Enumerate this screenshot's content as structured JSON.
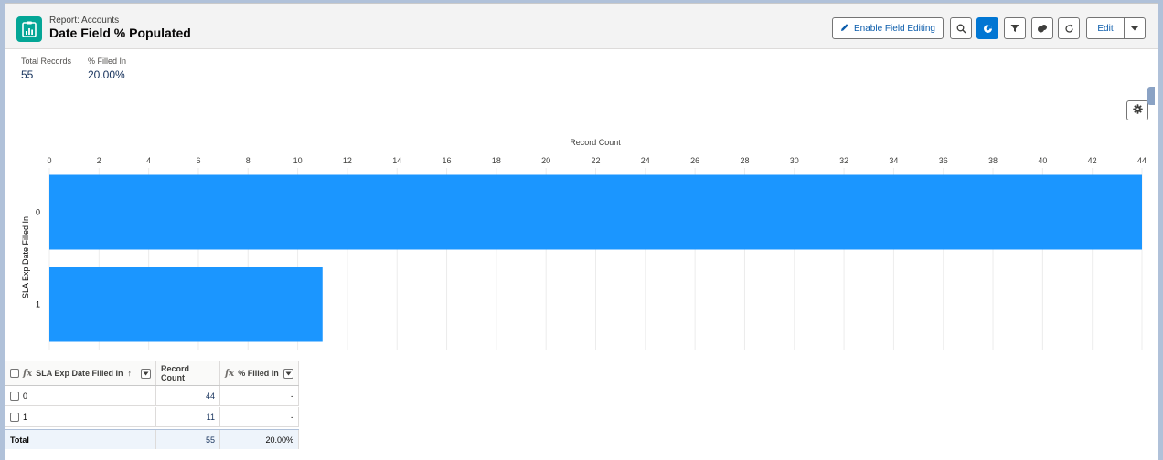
{
  "header": {
    "breadcrumb": "Report: Accounts",
    "title": "Date Field % Populated",
    "enable_field_editing_label": "Enable Field Editing",
    "edit_label": "Edit"
  },
  "summary": {
    "total_records_label": "Total Records",
    "total_records_value": "55",
    "filled_in_label": "% Filled In",
    "filled_in_value": "20.00%"
  },
  "chart_data": {
    "type": "bar",
    "orientation": "horizontal",
    "categories": [
      "0",
      "1"
    ],
    "values": [
      44,
      11
    ],
    "xlabel": "Record Count",
    "ylabel": "SLA Exp Date Filled In",
    "xlim": [
      0,
      44
    ],
    "xticks": [
      "0",
      "2",
      "4",
      "6",
      "8",
      "10",
      "12",
      "14",
      "16",
      "18",
      "20",
      "22",
      "24",
      "26",
      "28",
      "30",
      "32",
      "34",
      "36",
      "38",
      "40",
      "42",
      "44"
    ],
    "grid": true,
    "bar_color": "#1b96ff"
  },
  "table": {
    "columns": [
      {
        "label": "SLA Exp Date Filled In"
      },
      {
        "label": "Record Count"
      },
      {
        "label": "% Filled In"
      }
    ],
    "sort_indicator": "↑",
    "fx_glyph": "fx",
    "rows": [
      {
        "group": "0",
        "record_count": "44",
        "filled_in": "-"
      },
      {
        "group": "1",
        "record_count": "11",
        "filled_in": "-"
      }
    ],
    "total": {
      "label": "Total",
      "record_count": "55",
      "filled_in": "20.00%"
    }
  },
  "icons": [
    "report-app-icon",
    "pencil-icon",
    "search-icon",
    "chart-icon",
    "filter-icon",
    "toggle-icon",
    "refresh-icon",
    "chevron-down-icon",
    "gear-icon",
    "fx-icon",
    "dropdown-icon"
  ],
  "colors": {
    "accent": "#0176d3",
    "app_icon": "#04a696",
    "bar": "#1b96ff"
  }
}
